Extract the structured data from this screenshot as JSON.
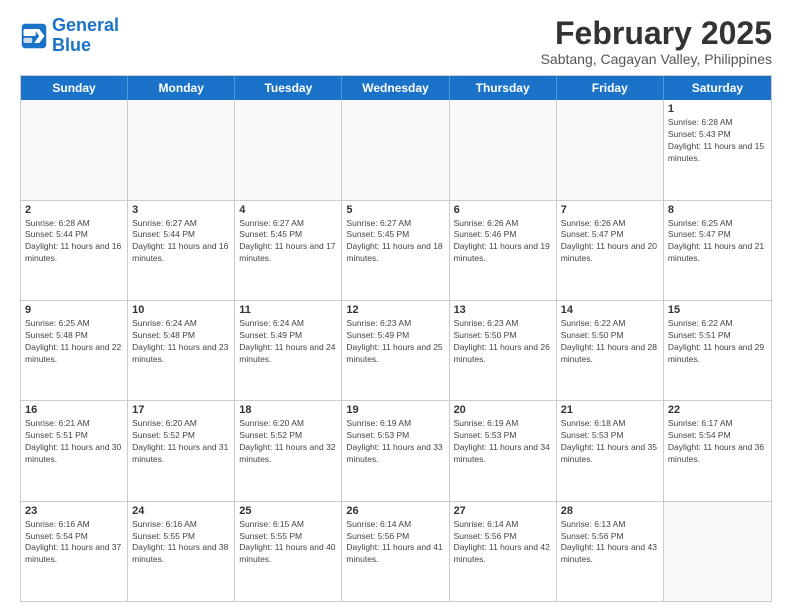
{
  "logo": {
    "line1": "General",
    "line2": "Blue"
  },
  "title": "February 2025",
  "subtitle": "Sabtang, Cagayan Valley, Philippines",
  "days_of_week": [
    "Sunday",
    "Monday",
    "Tuesday",
    "Wednesday",
    "Thursday",
    "Friday",
    "Saturday"
  ],
  "weeks": [
    [
      {
        "day": "",
        "info": ""
      },
      {
        "day": "",
        "info": ""
      },
      {
        "day": "",
        "info": ""
      },
      {
        "day": "",
        "info": ""
      },
      {
        "day": "",
        "info": ""
      },
      {
        "day": "",
        "info": ""
      },
      {
        "day": "1",
        "info": "Sunrise: 6:28 AM\nSunset: 5:43 PM\nDaylight: 11 hours and 15 minutes."
      }
    ],
    [
      {
        "day": "2",
        "info": "Sunrise: 6:28 AM\nSunset: 5:44 PM\nDaylight: 11 hours and 16 minutes."
      },
      {
        "day": "3",
        "info": "Sunrise: 6:27 AM\nSunset: 5:44 PM\nDaylight: 11 hours and 16 minutes."
      },
      {
        "day": "4",
        "info": "Sunrise: 6:27 AM\nSunset: 5:45 PM\nDaylight: 11 hours and 17 minutes."
      },
      {
        "day": "5",
        "info": "Sunrise: 6:27 AM\nSunset: 5:45 PM\nDaylight: 11 hours and 18 minutes."
      },
      {
        "day": "6",
        "info": "Sunrise: 6:26 AM\nSunset: 5:46 PM\nDaylight: 11 hours and 19 minutes."
      },
      {
        "day": "7",
        "info": "Sunrise: 6:26 AM\nSunset: 5:47 PM\nDaylight: 11 hours and 20 minutes."
      },
      {
        "day": "8",
        "info": "Sunrise: 6:25 AM\nSunset: 5:47 PM\nDaylight: 11 hours and 21 minutes."
      }
    ],
    [
      {
        "day": "9",
        "info": "Sunrise: 6:25 AM\nSunset: 5:48 PM\nDaylight: 11 hours and 22 minutes."
      },
      {
        "day": "10",
        "info": "Sunrise: 6:24 AM\nSunset: 5:48 PM\nDaylight: 11 hours and 23 minutes."
      },
      {
        "day": "11",
        "info": "Sunrise: 6:24 AM\nSunset: 5:49 PM\nDaylight: 11 hours and 24 minutes."
      },
      {
        "day": "12",
        "info": "Sunrise: 6:23 AM\nSunset: 5:49 PM\nDaylight: 11 hours and 25 minutes."
      },
      {
        "day": "13",
        "info": "Sunrise: 6:23 AM\nSunset: 5:50 PM\nDaylight: 11 hours and 26 minutes."
      },
      {
        "day": "14",
        "info": "Sunrise: 6:22 AM\nSunset: 5:50 PM\nDaylight: 11 hours and 28 minutes."
      },
      {
        "day": "15",
        "info": "Sunrise: 6:22 AM\nSunset: 5:51 PM\nDaylight: 11 hours and 29 minutes."
      }
    ],
    [
      {
        "day": "16",
        "info": "Sunrise: 6:21 AM\nSunset: 5:51 PM\nDaylight: 11 hours and 30 minutes."
      },
      {
        "day": "17",
        "info": "Sunrise: 6:20 AM\nSunset: 5:52 PM\nDaylight: 11 hours and 31 minutes."
      },
      {
        "day": "18",
        "info": "Sunrise: 6:20 AM\nSunset: 5:52 PM\nDaylight: 11 hours and 32 minutes."
      },
      {
        "day": "19",
        "info": "Sunrise: 6:19 AM\nSunset: 5:53 PM\nDaylight: 11 hours and 33 minutes."
      },
      {
        "day": "20",
        "info": "Sunrise: 6:19 AM\nSunset: 5:53 PM\nDaylight: 11 hours and 34 minutes."
      },
      {
        "day": "21",
        "info": "Sunrise: 6:18 AM\nSunset: 5:53 PM\nDaylight: 11 hours and 35 minutes."
      },
      {
        "day": "22",
        "info": "Sunrise: 6:17 AM\nSunset: 5:54 PM\nDaylight: 11 hours and 36 minutes."
      }
    ],
    [
      {
        "day": "23",
        "info": "Sunrise: 6:16 AM\nSunset: 5:54 PM\nDaylight: 11 hours and 37 minutes."
      },
      {
        "day": "24",
        "info": "Sunrise: 6:16 AM\nSunset: 5:55 PM\nDaylight: 11 hours and 38 minutes."
      },
      {
        "day": "25",
        "info": "Sunrise: 6:15 AM\nSunset: 5:55 PM\nDaylight: 11 hours and 40 minutes."
      },
      {
        "day": "26",
        "info": "Sunrise: 6:14 AM\nSunset: 5:56 PM\nDaylight: 11 hours and 41 minutes."
      },
      {
        "day": "27",
        "info": "Sunrise: 6:14 AM\nSunset: 5:56 PM\nDaylight: 11 hours and 42 minutes."
      },
      {
        "day": "28",
        "info": "Sunrise: 6:13 AM\nSunset: 5:56 PM\nDaylight: 11 hours and 43 minutes."
      },
      {
        "day": "",
        "info": ""
      }
    ]
  ]
}
